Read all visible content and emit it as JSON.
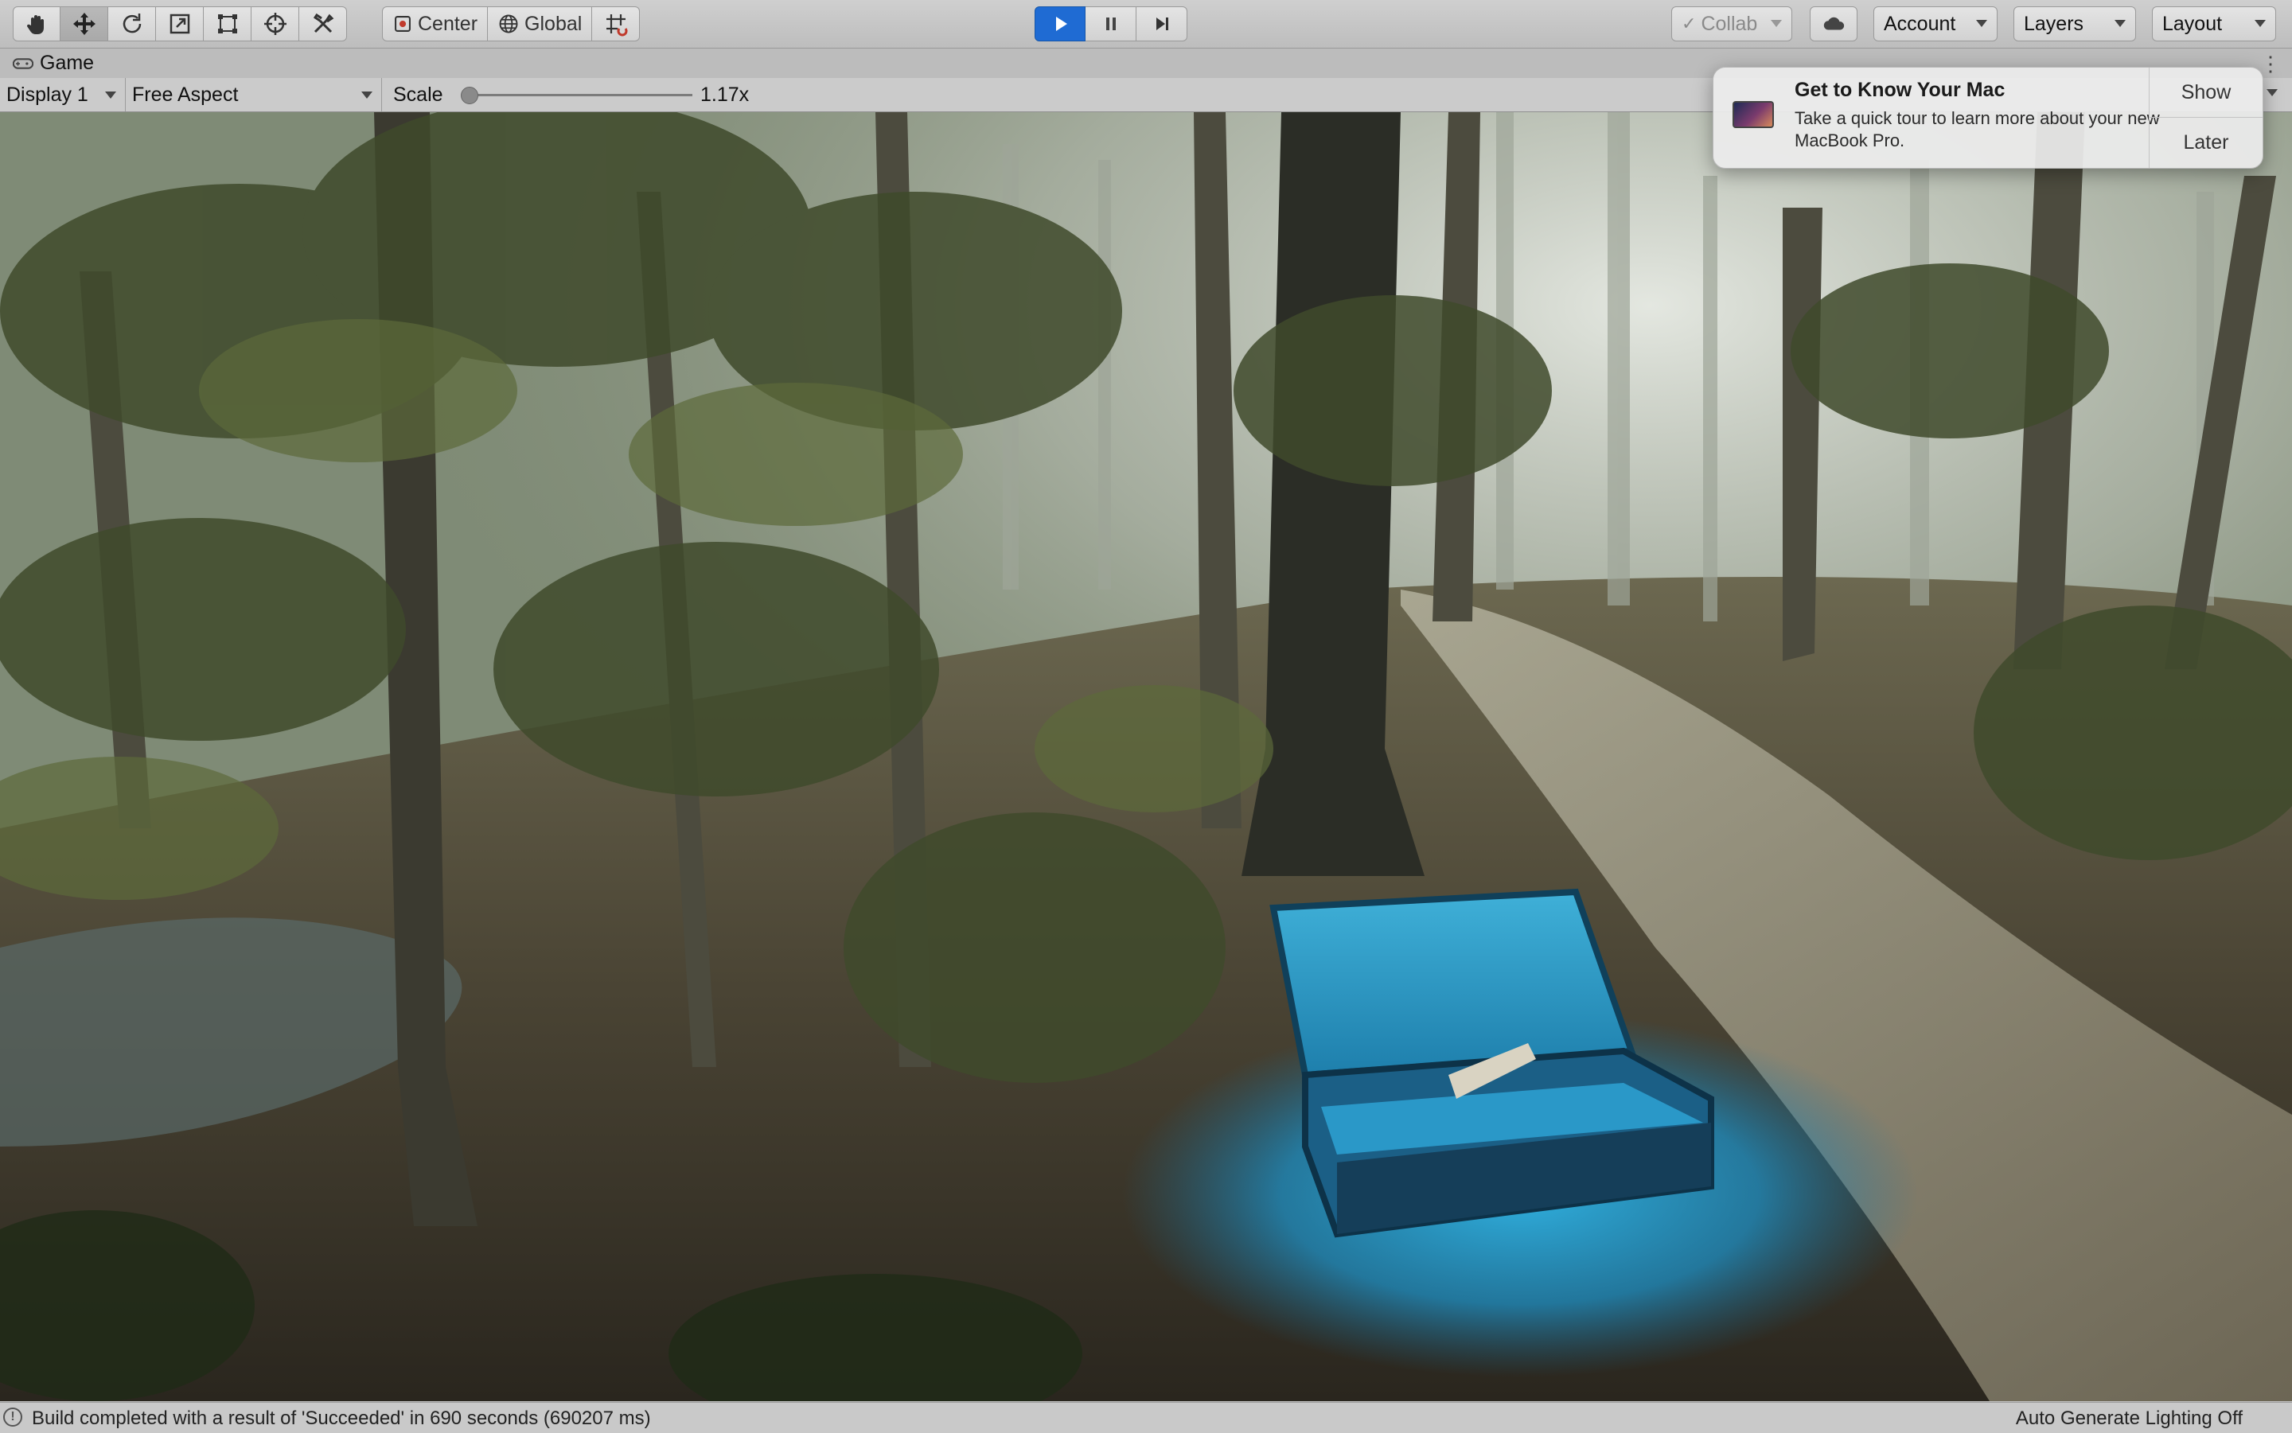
{
  "toolbar": {
    "tools": [
      {
        "name": "hand-tool-icon"
      },
      {
        "name": "move-tool-icon"
      },
      {
        "name": "rotate-tool-icon"
      },
      {
        "name": "scale-tool-icon"
      },
      {
        "name": "rect-tool-icon"
      },
      {
        "name": "transform-tool-icon"
      },
      {
        "name": "custom-tool-icon"
      }
    ],
    "pivot_mode": "Center",
    "pivot_rotation": "Global",
    "collab_label": "Collab",
    "account_label": "Account",
    "layers_label": "Layers",
    "layout_label": "Layout",
    "play_color": "#1f6bd3"
  },
  "game_tab": {
    "label": "Game"
  },
  "game_toolbar": {
    "display": "Display 1",
    "aspect": "Free Aspect",
    "scale_label": "Scale",
    "scale_value": "1.17x",
    "scale_fraction": 0.03
  },
  "notification": {
    "title": "Get to Know Your Mac",
    "body": "Take a quick tour to learn more about your new MacBook Pro.",
    "show_label": "Show",
    "later_label": "Later"
  },
  "status": {
    "message": "Build completed with a result of 'Succeeded' in 690 seconds (690207 ms)",
    "lighting": "Auto Generate Lighting Off"
  }
}
